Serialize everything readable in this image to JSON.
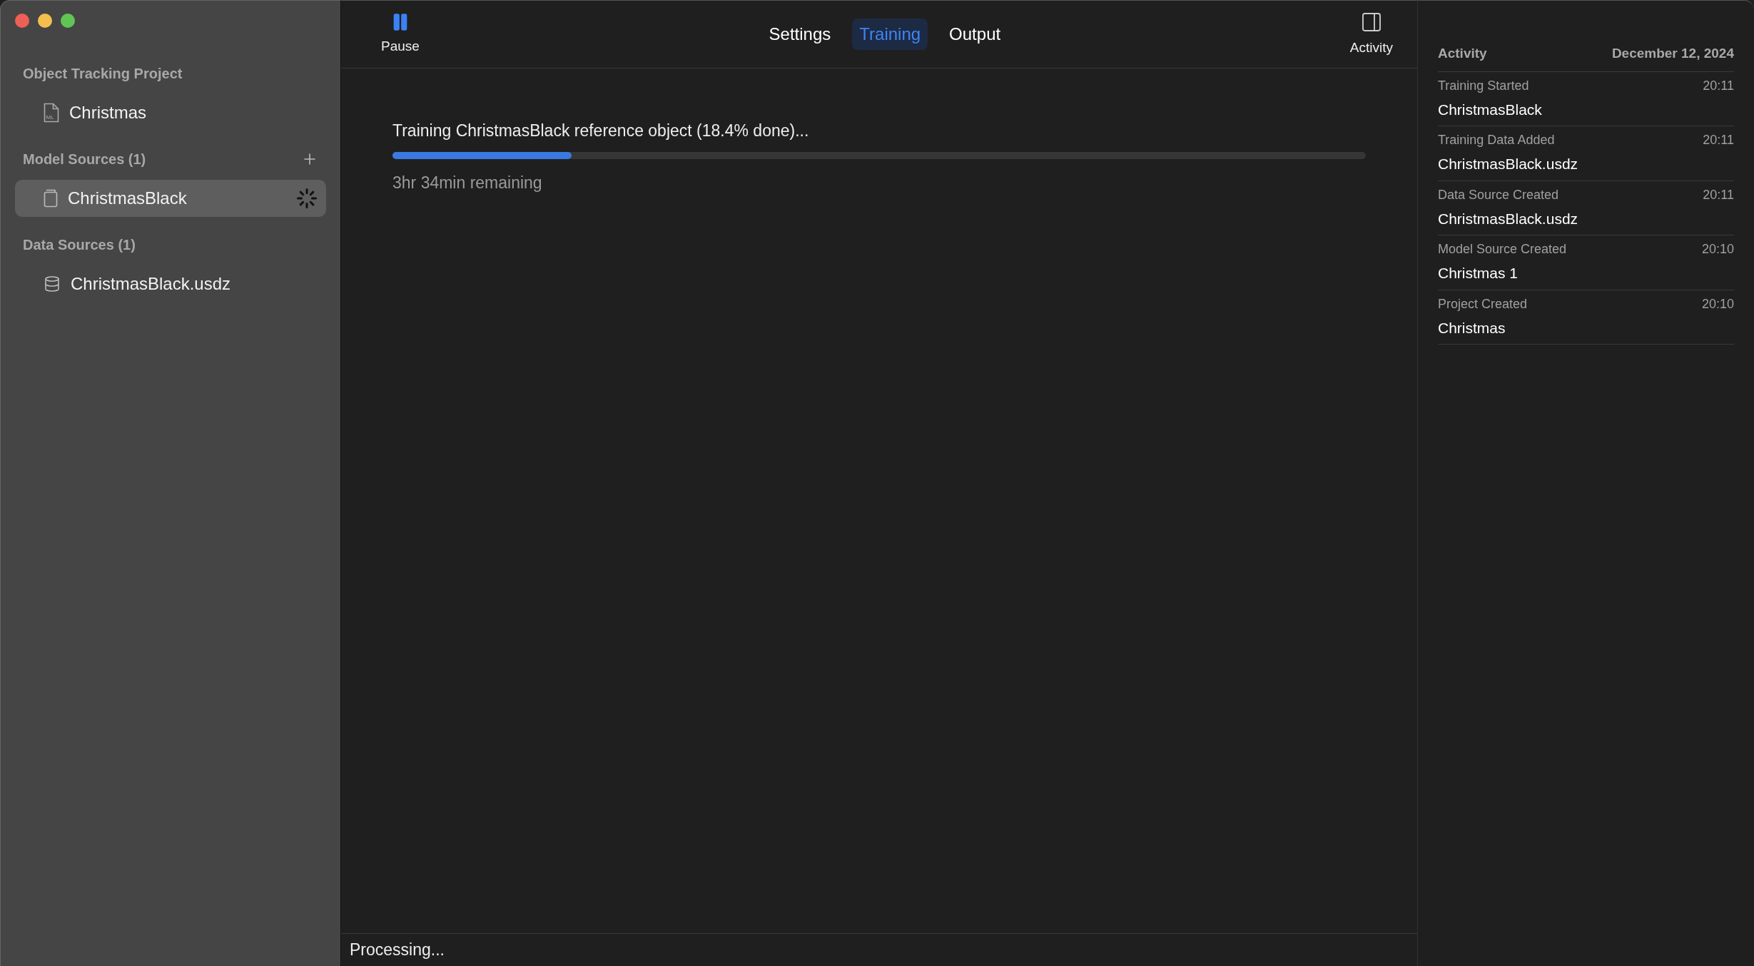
{
  "toolbar": {
    "pause": {
      "label": "Pause"
    },
    "tabs": [
      {
        "label": "Settings",
        "selected": false
      },
      {
        "label": "Training",
        "selected": true
      },
      {
        "label": "Output",
        "selected": false
      }
    ],
    "activity_toggle": {
      "label": "Activity"
    }
  },
  "sidebar": {
    "sections": [
      {
        "title": "Object Tracking Project",
        "add_button": false,
        "items": [
          {
            "label": "Christmas",
            "kind": "project",
            "icon_text": "ML",
            "selected": false,
            "busy": false
          }
        ]
      },
      {
        "title": "Model Sources (1)",
        "add_button": true,
        "items": [
          {
            "label": "ChristmasBlack",
            "kind": "model",
            "selected": true,
            "busy": true
          }
        ]
      },
      {
        "title": "Data Sources (1)",
        "add_button": false,
        "items": [
          {
            "label": "ChristmasBlack.usdz",
            "kind": "data",
            "selected": false,
            "busy": false
          }
        ]
      }
    ]
  },
  "training": {
    "message": "Training ChristmasBlack reference object (18.4% done)...",
    "level": 0.184,
    "remaining": "3hr 34min remaining"
  },
  "activity": {
    "title": "Activity",
    "date": "December 12, 2024",
    "events": [
      {
        "event": "Training Started",
        "time": "20:11",
        "subject": "ChristmasBlack"
      },
      {
        "event": "Training Data Added",
        "time": "20:11",
        "subject": "ChristmasBlack.usdz"
      },
      {
        "event": "Data Source Created",
        "time": "20:11",
        "subject": "ChristmasBlack.usdz"
      },
      {
        "event": "Model Source Created",
        "time": "20:10",
        "subject": "Christmas 1"
      },
      {
        "event": "Project Created",
        "time": "20:10",
        "subject": "Christmas"
      }
    ]
  },
  "status_bar": "Processing..."
}
